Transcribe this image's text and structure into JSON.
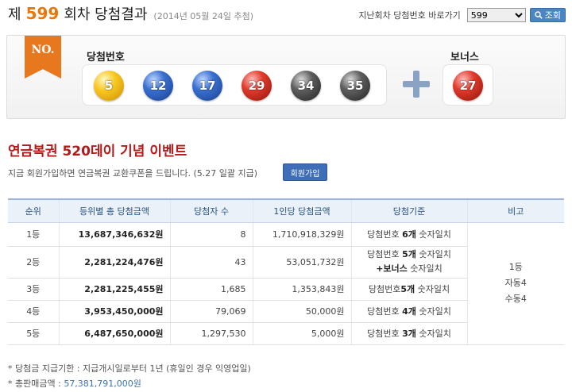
{
  "header": {
    "prefix": "제",
    "round": "599",
    "suffix": "회차 당첨결과",
    "date": "(2014년 05월 24일 추첨)"
  },
  "jump": {
    "label": "지난회차 당첨번호 바로가기",
    "selected": "599",
    "search_label": "조회"
  },
  "result": {
    "ribbon": "NO.",
    "main_label": "당첨번호",
    "bonus_label": "보너스",
    "numbers": [
      "5",
      "12",
      "17",
      "29",
      "34",
      "35"
    ],
    "bonus": "27"
  },
  "event": {
    "title": "연금복권 520데이 기념 이벤트",
    "desc": "지금 회원가입하면 연금복권 교환쿠폰을 드립니다. (5.27 일괄 지급)",
    "join_label": "회원가입"
  },
  "table": {
    "headers": [
      "순위",
      "등위별 총 당첨금액",
      "당첨자 수",
      "1인당 당첨금액",
      "당첨기준",
      "비고"
    ],
    "rows": [
      {
        "rank": "1등",
        "total": "13,687,346,632원",
        "winners": "8",
        "per": "1,710,918,329원",
        "crit_a": "당첨번호",
        "crit_b": "6개",
        "crit_c": "숫자일치",
        "crit_d": "",
        "crit_e": ""
      },
      {
        "rank": "2등",
        "total": "2,281,224,476원",
        "winners": "43",
        "per": "53,051,732원",
        "crit_a": "당첨번호",
        "crit_b": "5개",
        "crit_c": "숫자일치",
        "crit_d": "+보너스",
        "crit_e": "숫자일치"
      },
      {
        "rank": "3등",
        "total": "2,281,225,455원",
        "winners": "1,685",
        "per": "1,353,843원",
        "crit_a": "당첨번호",
        "crit_b": "5개",
        "crit_c": "숫자일치",
        "crit_d": "",
        "crit_e": ""
      },
      {
        "rank": "4등",
        "total": "3,953,450,000원",
        "winners": "79,069",
        "per": "50,000원",
        "crit_a": "당첨번호",
        "crit_b": "4개",
        "crit_c": "숫자일치",
        "crit_d": "",
        "crit_e": ""
      },
      {
        "rank": "5등",
        "total": "6,487,650,000원",
        "winners": "1,297,530",
        "per": "5,000원",
        "crit_a": "당첨번호",
        "crit_b": "3개",
        "crit_c": "숫자일치",
        "crit_d": "",
        "crit_e": ""
      }
    ],
    "note": [
      "1등",
      "자동4",
      "수동4"
    ]
  },
  "footer": {
    "deadline": "* 당첨금 지급기한 : 지급개시일로부터 1년 (휴일인 경우 익영업일)",
    "sales_label": "* 총판매금액 :",
    "sales_value": "57,381,791,000원"
  },
  "colors": {
    "round": "#e8780c",
    "event_title": "#b31a1a",
    "header_blue": "#26527e",
    "button_blue": "#3f6eb8"
  }
}
